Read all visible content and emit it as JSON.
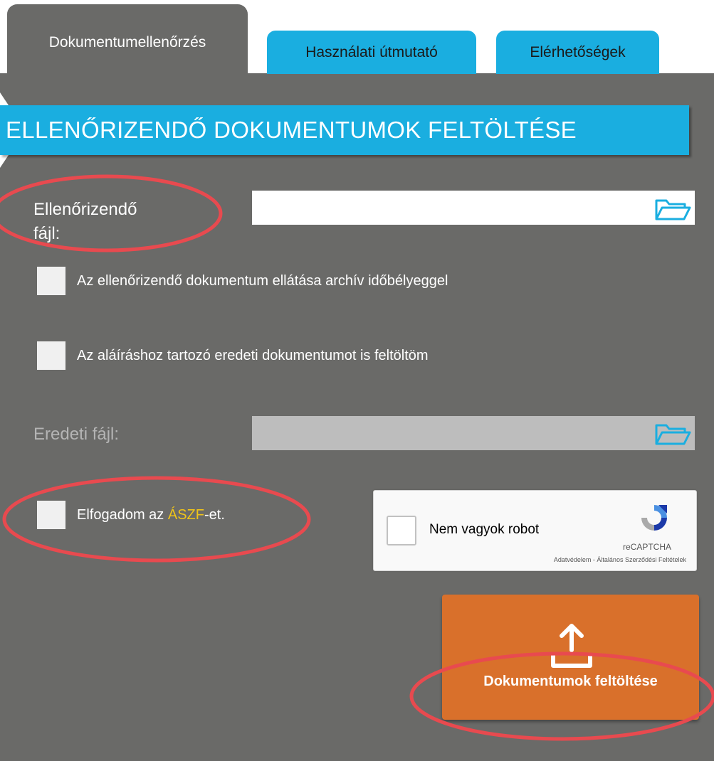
{
  "tabs": [
    {
      "label": "Dokumentumellenőrzés",
      "active": true
    },
    {
      "label": "Használati útmutató",
      "active": false
    },
    {
      "label": "Elérhetőségek",
      "active": false
    }
  ],
  "header": {
    "title": "ELLENŐRIZENDŐ DOKUMENTUMOK FELTÖLTÉSE"
  },
  "form": {
    "file_label_line1": "Ellenőrizendő",
    "file_label_line2": "fájl:",
    "archive_checkbox_label": "Az ellenőrizendő dokumentum ellátása archív időbélyeggel",
    "original_checkbox_label": "Az aláíráshoz tartozó eredeti dokumentumot is feltöltöm",
    "original_file_label": "Eredeti fájl:",
    "terms_prefix": "Elfogadom az ",
    "terms_link": "ÁSZF",
    "terms_suffix": "-et."
  },
  "recaptcha": {
    "label": "Nem vagyok robot",
    "brand": "reCAPTCHA",
    "links": "Adatvédelem - Általános Szerződési Feltételek"
  },
  "upload": {
    "label": "Dokumentumok feltöltése",
    "icon": "upload-arrow-icon"
  },
  "colors": {
    "panel": "#6a6a68",
    "accent_blue": "#1aaee0",
    "upload_orange": "#d9702b",
    "link_yellow": "#f0c419",
    "annotation_red": "#e84a4f"
  }
}
